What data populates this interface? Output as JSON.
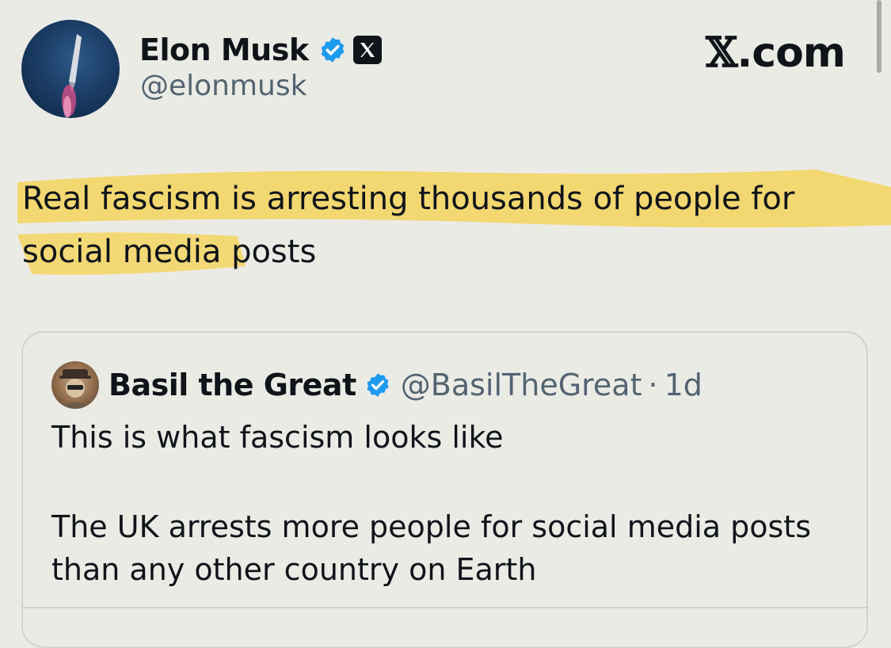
{
  "author": {
    "display_name": "Elon Musk",
    "handle": "@elonmusk",
    "verified_icon": "verified-badge-icon",
    "affiliation_icon": "x-logo-icon"
  },
  "brand": {
    "glyph": "𝕏",
    "suffix": ".com"
  },
  "tweet": {
    "line1": "Real fascism is arresting thousands of people for",
    "line2": "social media posts"
  },
  "quoted": {
    "display_name": "Basil the Great",
    "handle": "@BasilTheGreat",
    "separator": "·",
    "time": "1d",
    "text_line1": "This is what fascism looks like",
    "text_line2": "The UK arrests more people for social media posts than any other country on Earth"
  },
  "colors": {
    "background": "#ebebe6",
    "text": "#0f1419",
    "muted": "#536471",
    "verified_blue": "#1d9bf0",
    "highlight": "#f5d35a"
  }
}
